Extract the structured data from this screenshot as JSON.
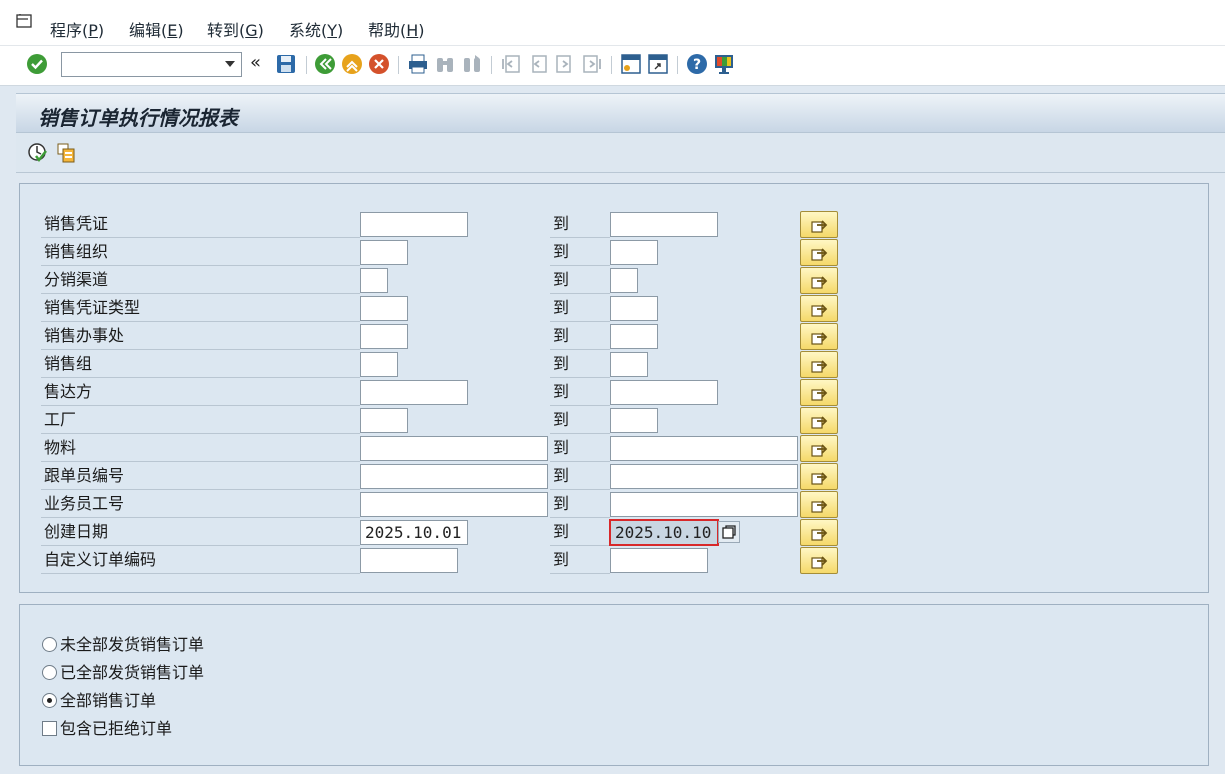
{
  "menu": [
    {
      "label": "程序(",
      "key": "P",
      "end": ")"
    },
    {
      "label": "编辑(",
      "key": "E",
      "end": ")"
    },
    {
      "label": "转到(",
      "key": "G",
      "end": ")"
    },
    {
      "label": "系统(",
      "key": "Y",
      "end": ")"
    },
    {
      "label": "帮助(",
      "key": "H",
      "end": ")"
    }
  ],
  "toolbar": {
    "command_field_value": "",
    "back_symbol": "«"
  },
  "title": "销售订单执行情况报表",
  "selection": {
    "to_label": "到",
    "rows": [
      {
        "label": "销售凭证",
        "low": "",
        "high": ""
      },
      {
        "label": "销售组织",
        "low": "",
        "high": ""
      },
      {
        "label": "分销渠道",
        "low": "",
        "high": ""
      },
      {
        "label": "销售凭证类型",
        "low": "",
        "high": ""
      },
      {
        "label": "销售办事处",
        "low": "",
        "high": ""
      },
      {
        "label": "销售组",
        "low": "",
        "high": ""
      },
      {
        "label": "售达方",
        "low": "",
        "high": ""
      },
      {
        "label": "工厂",
        "low": "",
        "high": ""
      },
      {
        "label": "物料",
        "low": "",
        "high": ""
      },
      {
        "label": "跟单员编号",
        "low": "",
        "high": ""
      },
      {
        "label": "业务员工号",
        "low": "",
        "high": ""
      },
      {
        "label": "创建日期",
        "low": "2025.10.01",
        "high": "2025.10.10"
      },
      {
        "label": "自定义订单编码",
        "low": "",
        "high": ""
      }
    ]
  },
  "options": {
    "radio1": "未全部发货销售订单",
    "radio2": "已全部发货销售订单",
    "radio3": "全部销售订单",
    "checkbox": "包含已拒绝订单",
    "selected": "radio3"
  },
  "colors": {
    "accent": "#f5d96a",
    "background": "#dfe8f1",
    "focus": "#d8282a"
  }
}
